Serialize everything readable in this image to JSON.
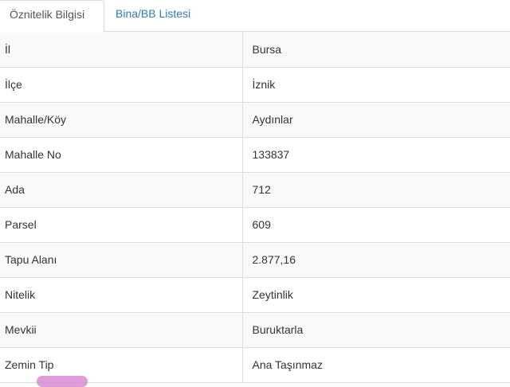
{
  "tabs": [
    {
      "label": "Öznitelik Bilgisi",
      "active": true
    },
    {
      "label": "Bina/BB Listesi",
      "active": false
    }
  ],
  "rows": [
    {
      "key": "İl",
      "value": "Bursa"
    },
    {
      "key": "İlçe",
      "value": "İznik"
    },
    {
      "key": "Mahalle/Köy",
      "value": "Aydınlar"
    },
    {
      "key": "Mahalle No",
      "value": "133837"
    },
    {
      "key": "Ada",
      "value": "712"
    },
    {
      "key": "Parsel",
      "value": "609"
    },
    {
      "key": "Tapu Alanı",
      "value": "2.877,16"
    },
    {
      "key": "Nitelik",
      "value": "Zeytinlik"
    },
    {
      "key": "Mevkii",
      "value": "Buruktarla"
    },
    {
      "key": "Zemin Tip",
      "value": "Ana Taşınmaz"
    }
  ],
  "colors": {
    "link": "#337ab7",
    "border": "#dddddd",
    "stripe": "#f9f9f9",
    "overlay_badge": "#d98bd4"
  }
}
